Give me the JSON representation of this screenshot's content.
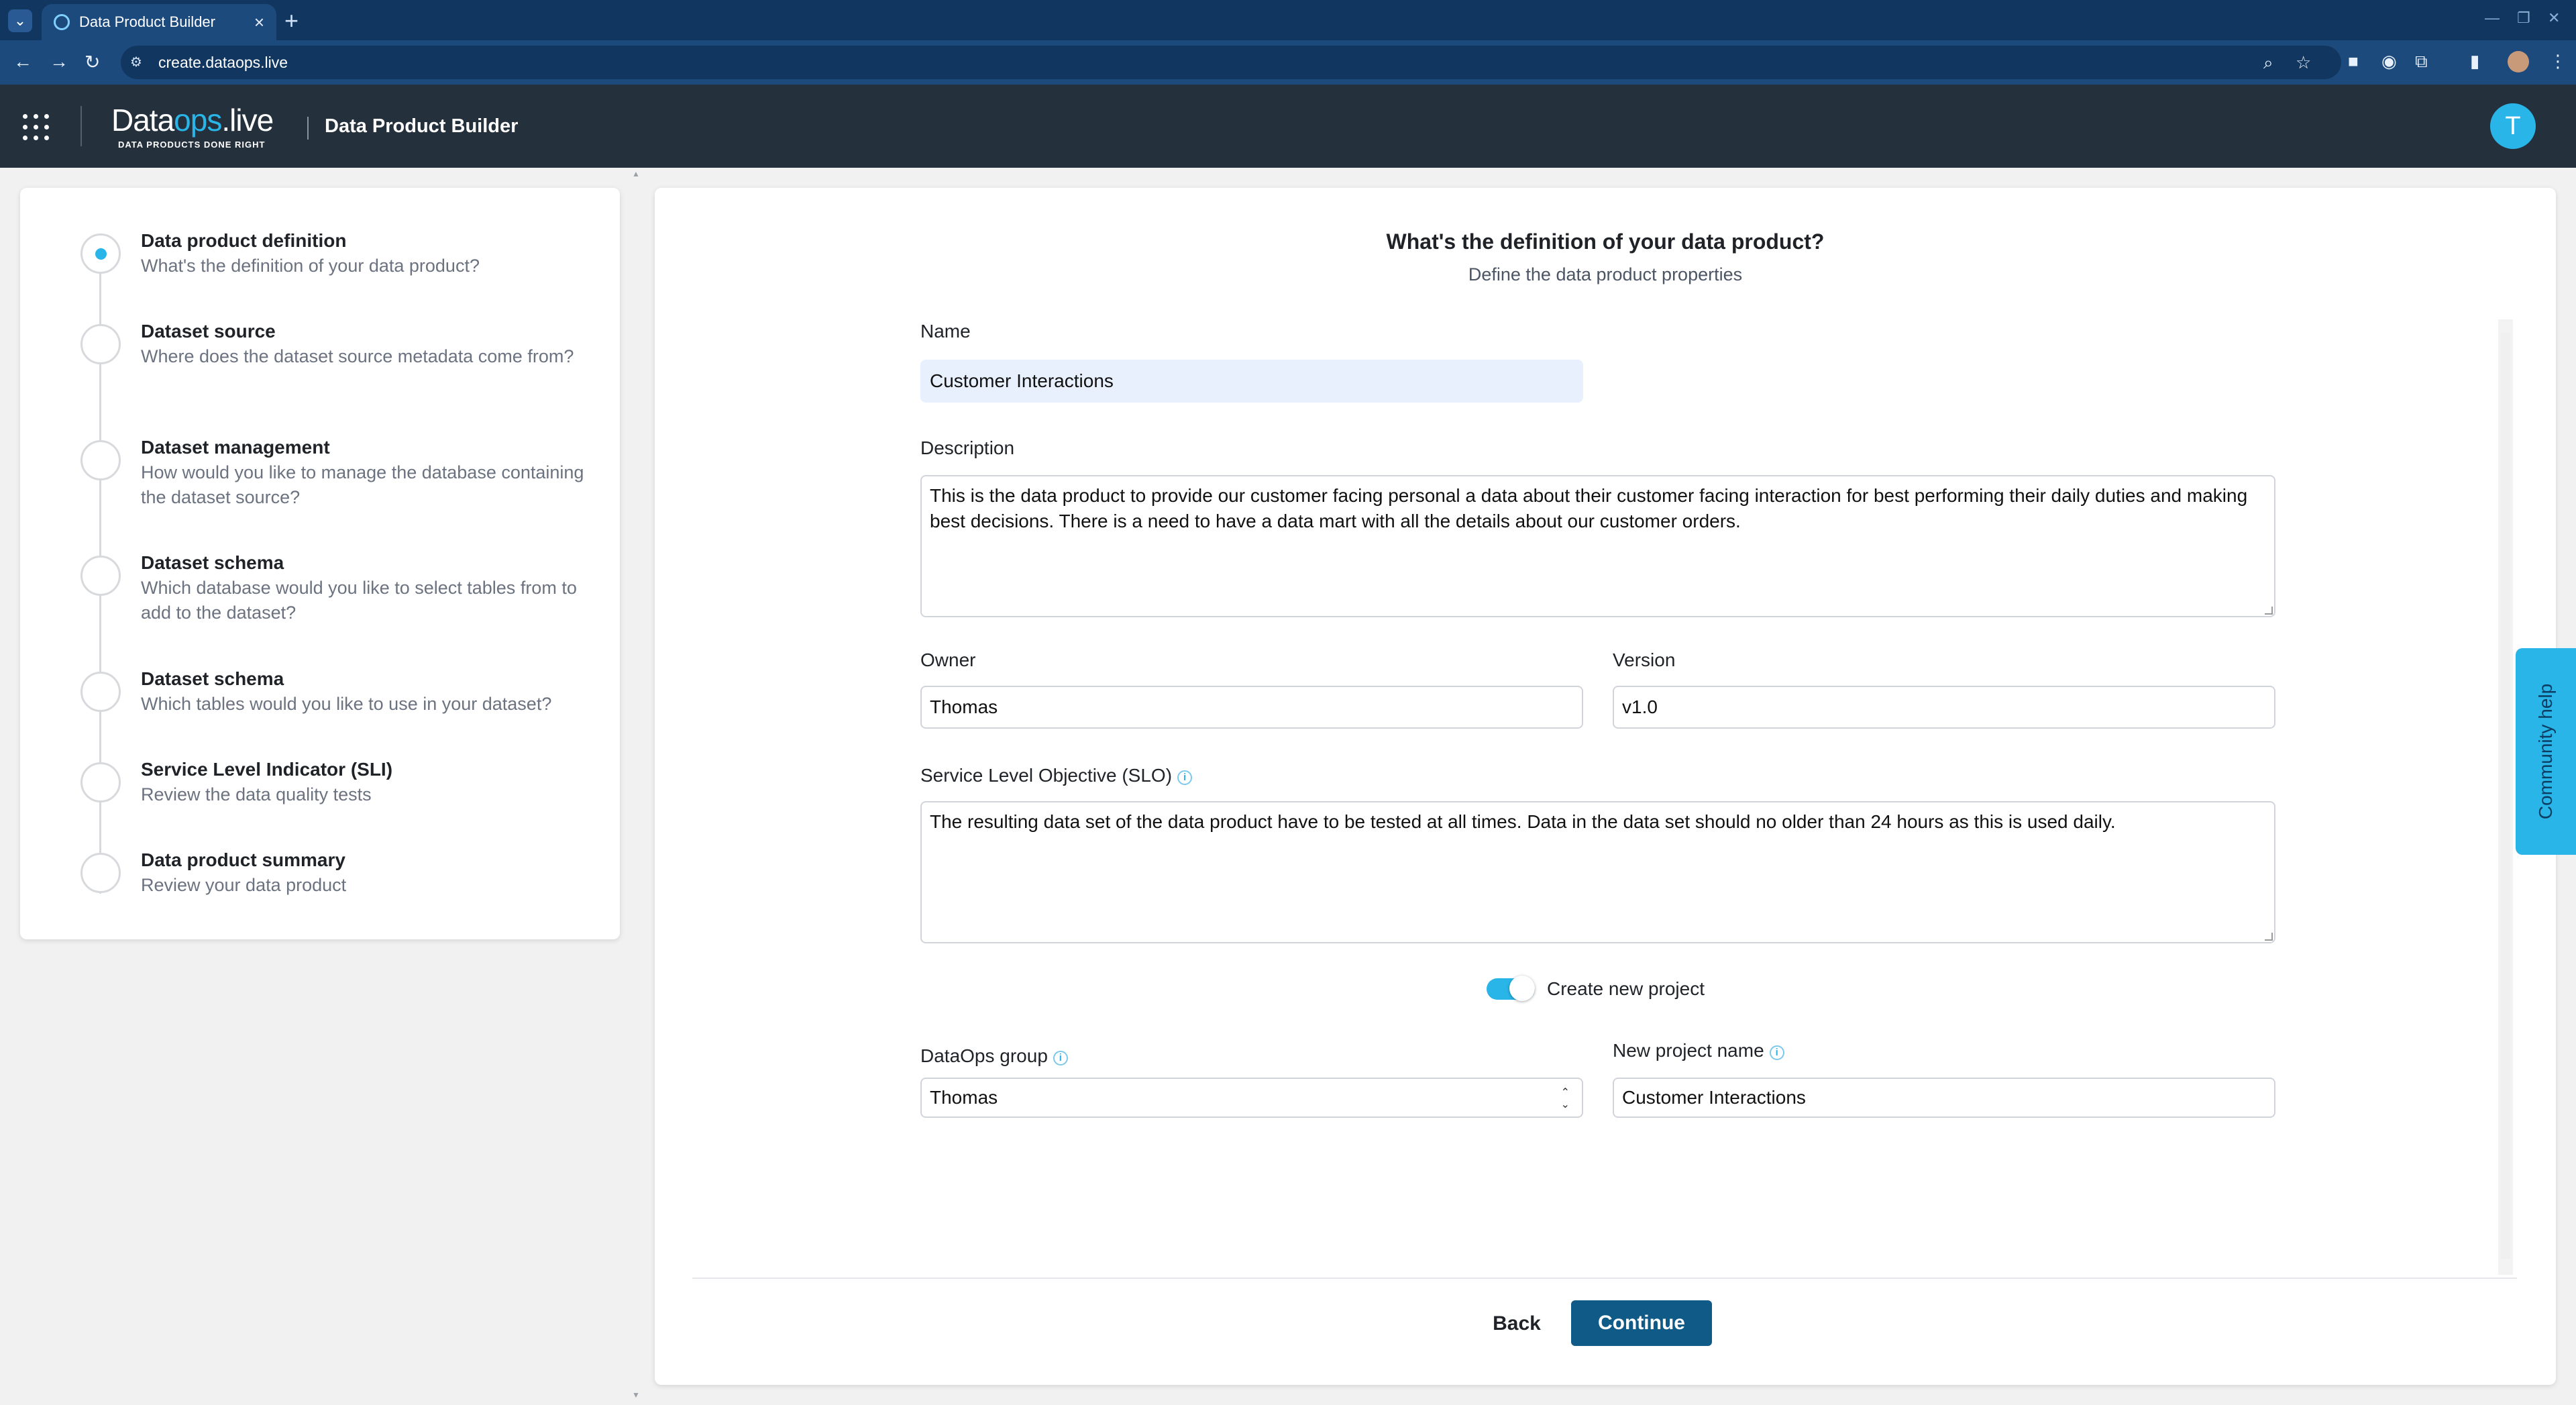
{
  "browser": {
    "tab_title": "Data Product Builder",
    "url": "create.dataops.live"
  },
  "app": {
    "logo_main_a": "Data",
    "logo_main_b": "ops",
    "logo_main_c": ".live",
    "logo_sub": "DATA PRODUCTS DONE RIGHT",
    "title": "Data Product Builder",
    "avatar_initial": "T"
  },
  "steps": [
    {
      "title": "Data product definition",
      "desc": "What's the definition of your data product?",
      "active": true
    },
    {
      "title": "Dataset source",
      "desc": "Where does the dataset source metadata come from?"
    },
    {
      "title": "Dataset management",
      "desc": "How would you like to manage the database containing the dataset source?"
    },
    {
      "title": "Dataset schema",
      "desc": "Which database would you like to select tables from to add to the dataset?"
    },
    {
      "title": "Dataset schema",
      "desc": "Which tables would you like to use in your dataset?"
    },
    {
      "title": "Service Level Indicator (SLI)",
      "desc": "Review the data quality tests"
    },
    {
      "title": "Data product summary",
      "desc": "Review your data product"
    }
  ],
  "form": {
    "heading": "What's the definition of your data product?",
    "subheading": "Define the data product properties",
    "name_label": "Name",
    "name_value": "Customer Interactions",
    "description_label": "Description",
    "description_value": "This is the data product to provide our customer facing personal a data about their customer facing interaction for best performing their daily duties and making best decisions. There is a need to have a data mart with all the details about our customer orders.",
    "owner_label": "Owner",
    "owner_value": "Thomas",
    "version_label": "Version",
    "version_value": "v1.0",
    "slo_label": "Service Level Objective (SLO)",
    "slo_value": "The resulting data set of the data product have to be tested at all times. Data in the data set should no older than 24 hours as this is used daily.",
    "toggle_label": "Create new project",
    "toggle_on": true,
    "group_label": "DataOps group",
    "group_value": "Thomas",
    "project_label": "New project name",
    "project_value": "Customer Interactions"
  },
  "actions": {
    "back": "Back",
    "continue": "Continue"
  },
  "community_help": "Community help",
  "colors": {
    "accent": "#29b5e8",
    "primary_button": "#0f5a87",
    "header": "#25303d",
    "browser": "#1d4a7d"
  }
}
